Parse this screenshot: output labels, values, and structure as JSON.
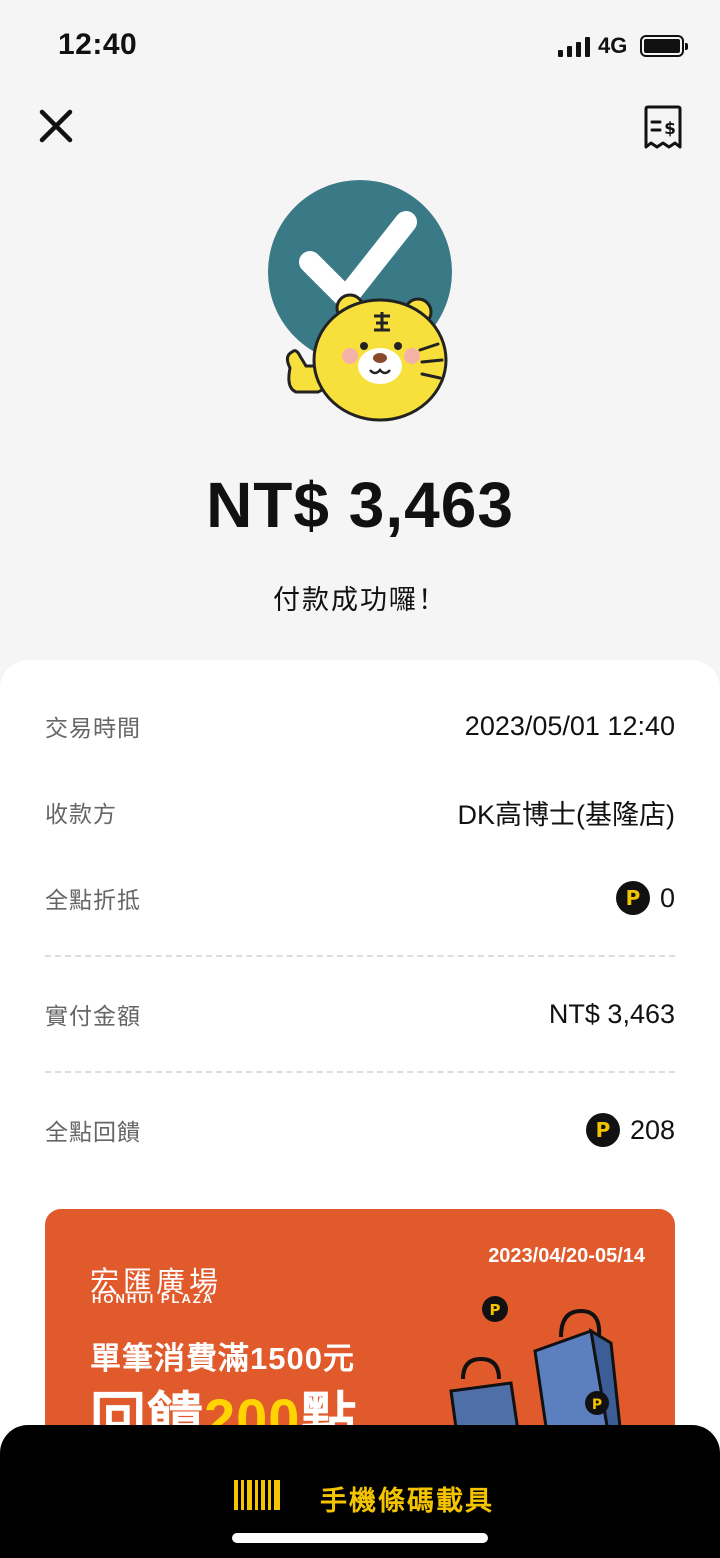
{
  "status_bar": {
    "time": "12:40",
    "network": "4G"
  },
  "hero": {
    "amount": "NT$ 3,463",
    "message": "付款成功囉！"
  },
  "details": {
    "rows": [
      {
        "label": "交易時間",
        "value": "2023/05/01 12:40"
      },
      {
        "label": "收款方",
        "value": "DK高博士(基隆店)"
      },
      {
        "label": "全點折抵",
        "value": "0"
      },
      {
        "label": "實付金額",
        "value": "NT$ 3,463"
      },
      {
        "label": "全點回饋",
        "value": "208"
      }
    ],
    "points_symbol": "P"
  },
  "promo": {
    "brand_cn": "宏匯廣場",
    "brand_en": "HONHUI PLAZA",
    "date_range": "2023/04/20-05/14",
    "line1": "單筆消費滿1500元",
    "line2_prefix": "回饋",
    "line2_highlight": "200",
    "line2_suffix": "點"
  },
  "bottom_bar": {
    "label": "手機條碼載具"
  },
  "colors": {
    "accent_yellow": "#f5c400",
    "check_circle": "#3a7a86",
    "promo_bg": "#e05a2b",
    "tiger": "#f7e03c"
  },
  "icons": [
    "close-icon",
    "receipt-icon",
    "check-icon",
    "tiger-mascot",
    "points-icon",
    "barcode-icon",
    "shopping-bags"
  ]
}
